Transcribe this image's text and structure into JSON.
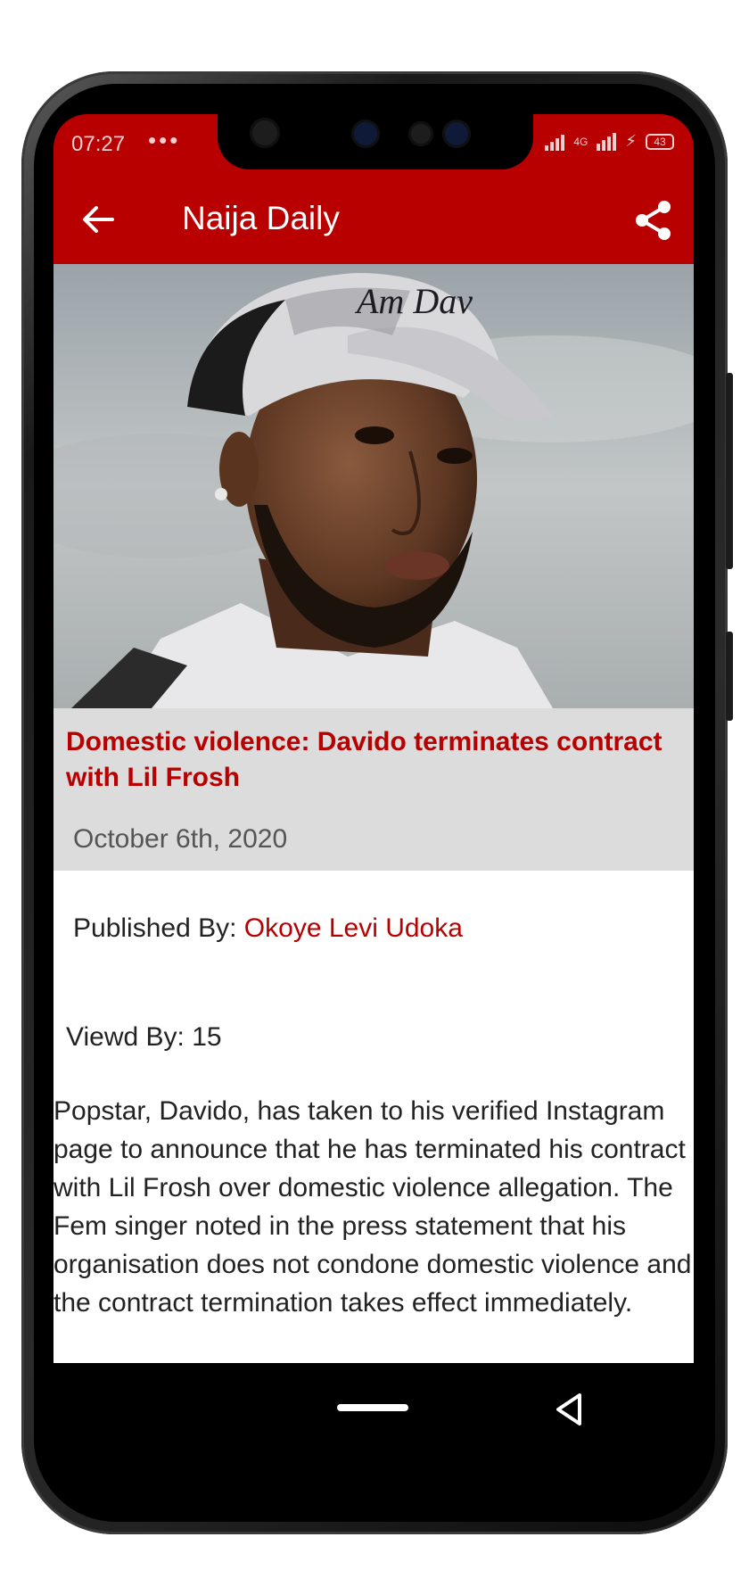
{
  "status_bar": {
    "time": "07:27",
    "dots": "•••",
    "network": "4G",
    "battery": "43"
  },
  "appbar": {
    "title": "Naija Daily",
    "background": "#b80000"
  },
  "hero": {
    "cap_text": "Am Dav"
  },
  "article": {
    "title": "Domestic violence: Davido terminates contract with Lil Frosh",
    "date": "October 6th, 2020",
    "published_by_label": "Published By:",
    "author": "Okoye Levi Udoka",
    "viewed_label": "Viewd By:",
    "views": "15",
    "body": "Popstar, Davido, has taken to his verified Instagram page to announce that he has terminated his contract with Lil Frosh over domestic violence allegation. The Fem singer noted in the press statement that his organisation does not condone domestic violence and the contract termination takes effect immediately."
  },
  "icons": {
    "back": "arrow-left-icon",
    "share": "share-icon",
    "nav_home": "home-pill-icon",
    "nav_back": "triangle-back-icon"
  }
}
